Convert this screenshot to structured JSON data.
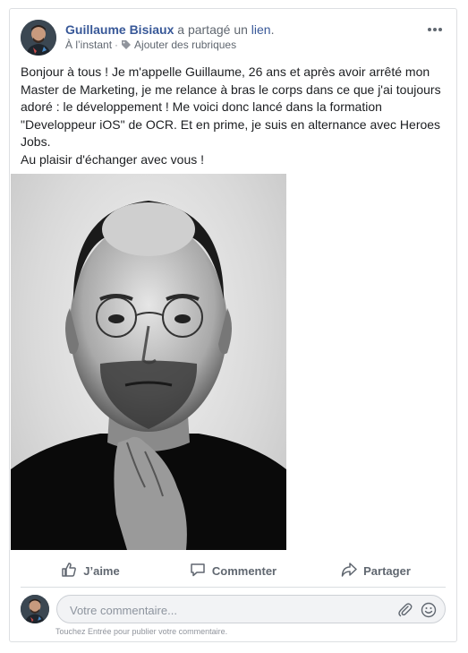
{
  "post": {
    "author": "Guillaume Bisiaux",
    "action_text": " a partagé un ",
    "action_link": "lien",
    "action_end": ".",
    "timestamp": "À l’instant",
    "separator": "·",
    "add_topics": "Ajouter des rubriques",
    "message": "Bonjour à tous ! Je m'appelle Guillaume, 26 ans et après avoir arrêté mon Master de Marketing, je me relance à bras le corps dans ce que j'ai toujours adoré : le développement ! Me voici donc lancé dans la formation \"Developpeur iOS\" de OCR. Et en prime, je suis en alternance avec Heroes Jobs.\nAu plaisir d'échanger avec vous !"
  },
  "actions": {
    "like": "J’aime",
    "comment": "Commenter",
    "share": "Partager"
  },
  "comment": {
    "placeholder": "Votre commentaire...",
    "hint": "Touchez Entrée pour publier votre commentaire."
  },
  "icons": {
    "more": "more-horizontal-icon",
    "tag": "tag-icon",
    "like": "thumbs-up-icon",
    "comment": "comment-bubble-icon",
    "share": "share-arrow-icon",
    "attach": "paperclip-icon",
    "emoji": "smiley-icon"
  },
  "colors": {
    "link": "#385898",
    "muted": "#606770",
    "border": "#dddfe2"
  }
}
